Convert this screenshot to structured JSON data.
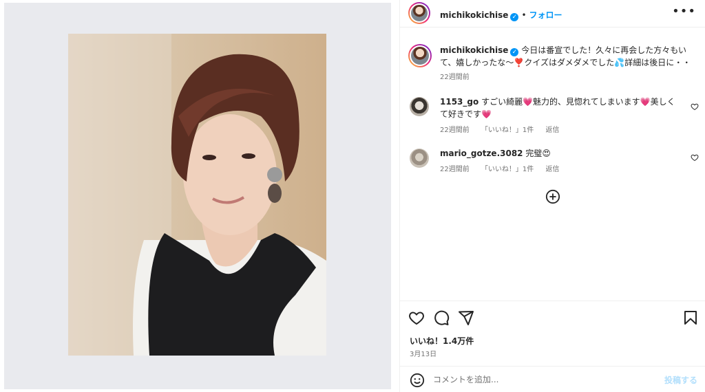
{
  "post": {
    "username": "michikokichise",
    "verified_mark": "✓",
    "separator": "•",
    "follow_label": "フォロー",
    "more_label": "•••",
    "caption": "今日は番宣でした！久々に再会した方々もいて、嬉しかったな〜❣️クイズはダメダメでした💦詳細は後日に・・",
    "caption_time": "22週間前"
  },
  "comments": [
    {
      "username": "1153_go",
      "text": "すごい綺麗💗魅力的、見惚れてしまいます💗美しくて好きです💗",
      "time": "22週間前",
      "likes": "「いいね！」1件",
      "reply": "返信"
    },
    {
      "username": "mario_gotze.3082",
      "text": "完璧😍",
      "time": "22週間前",
      "likes": "「いいね！」1件",
      "reply": "返信"
    }
  ],
  "actions": {
    "likes_text": "いいね！1.4万件",
    "date": "3月13日",
    "comment_placeholder": "コメントを追加...",
    "post_label": "投稿する"
  },
  "icons": {
    "like": "heart-icon",
    "comment": "comment-icon",
    "share": "share-icon",
    "save": "bookmark-icon",
    "emoji": "emoji-icon",
    "load_more": "plus-circle-icon"
  },
  "colors": {
    "accent": "#0095f6",
    "post_disabled": "#b2dffc",
    "muted": "#737373",
    "media_bg": "#e9eaee"
  }
}
